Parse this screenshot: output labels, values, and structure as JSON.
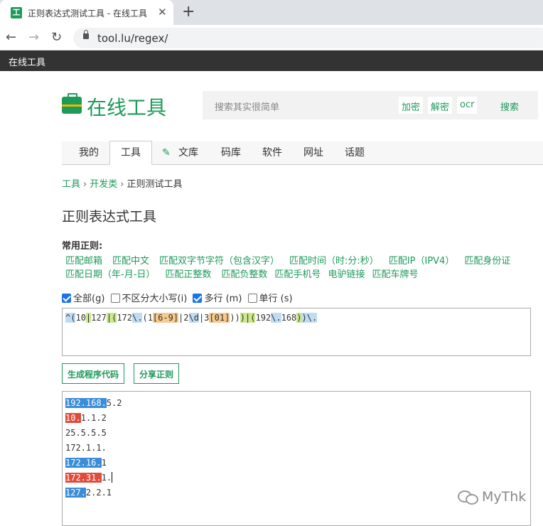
{
  "browser": {
    "tab_icon": "工",
    "tab_title": "正则表达式测试工具 - 在线工具",
    "close": "✕",
    "new_tab": "+",
    "back": "←",
    "forward": "→",
    "reload": "↻",
    "url": "tool.lu/regex/"
  },
  "site": {
    "top_title": "在线工具",
    "logo_text": "在线工具",
    "search": {
      "placeholder": "搜索其实很简单",
      "buttons": [
        "加密",
        "解密",
        "ocr"
      ],
      "submit": "搜索"
    },
    "nav": [
      "我的",
      "工具",
      "文库",
      "码库",
      "软件",
      "网址",
      "话题"
    ],
    "active_nav": "工具"
  },
  "breadcrumb": [
    "工具",
    "开发类",
    "正则测试工具"
  ],
  "page_title": "正则表达式工具",
  "common_label": "常用正则:",
  "patterns": [
    "匹配邮箱",
    "匹配中文",
    "匹配双字节字符（包含汉字）",
    "匹配时间（时:分:秒）",
    "匹配IP（IPV4）",
    "匹配身份证",
    "匹配日期（年-月-日）",
    "匹配正整数",
    "匹配负整数",
    "匹配手机号",
    "电驴链接",
    "匹配车牌号"
  ],
  "flags": [
    {
      "label": "全部(g)",
      "checked": true
    },
    {
      "label": "不区分大小写(i)",
      "checked": false
    },
    {
      "label": "多行 (m)",
      "checked": true
    },
    {
      "label": "单行 (s)",
      "checked": false
    }
  ],
  "regex": {
    "t1": "^",
    "t2": "(",
    "t3": "10",
    "t4": "|",
    "t5": "127",
    "t6": "|",
    "t7": "(",
    "t8": "172",
    "t9": "\\.",
    "t10": "(",
    "t11": "1",
    "t12": "[6-9]",
    "t13": "|2",
    "t14": "\\d",
    "t15": "|3",
    "t16": "[01]",
    "t17": "))",
    "t18": ")",
    "t19": "|",
    "t20": "(",
    "t21": "192",
    "t22": "\\.",
    "t23": "168",
    "t24": ")",
    "t25": ")",
    "t26": "\\."
  },
  "buttons": {
    "generate": "生成程序代码",
    "share": "分享正则"
  },
  "test_lines": [
    {
      "match": "192.168.",
      "rest": "5.2",
      "color": "#3b8dd9"
    },
    {
      "match": "10.",
      "rest": "1.1.2",
      "color": "#e04c3c"
    },
    {
      "match": "",
      "rest": "25.5.5.5"
    },
    {
      "match": "",
      "rest": "172.1.1."
    },
    {
      "match": "172.16.",
      "rest": "1",
      "color": "#3b8dd9"
    },
    {
      "match": "172.31.",
      "rest": "1.",
      "color": "#e04c3c"
    },
    {
      "match": "127.",
      "rest": "2.2.1",
      "color": "#3b8dd9"
    }
  ],
  "watermark": "MyThk"
}
